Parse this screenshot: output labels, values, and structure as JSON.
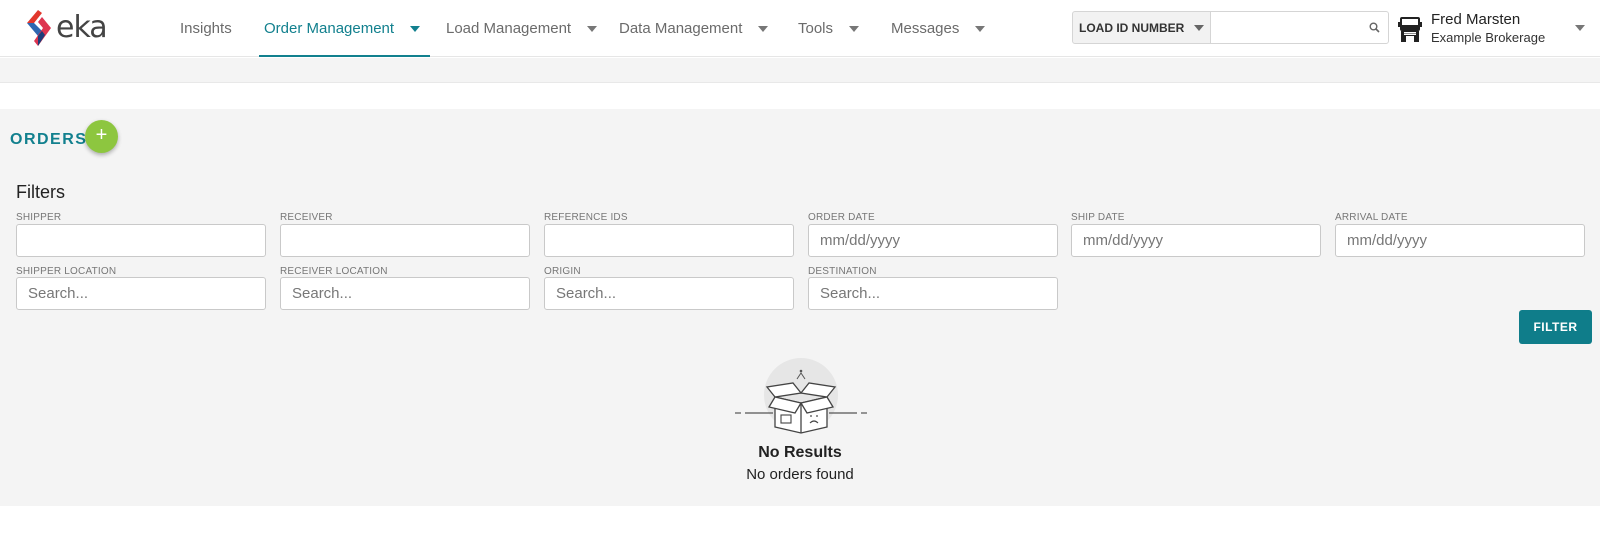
{
  "brand": {
    "logo_text": "eka"
  },
  "nav": {
    "items": [
      {
        "label": "Insights"
      },
      {
        "label": "Order Management"
      },
      {
        "label": "Load Management"
      },
      {
        "label": "Data Management"
      },
      {
        "label": "Tools"
      },
      {
        "label": "Messages"
      }
    ],
    "active": "Order Management"
  },
  "search": {
    "type_label": "LOAD ID NUMBER",
    "value": "",
    "placeholder": ""
  },
  "user": {
    "name": "Fred Marsten",
    "organization": "Example Brokerage"
  },
  "page": {
    "title": "ORDERS",
    "add_label": "+"
  },
  "filters": {
    "title": "Filters",
    "fields": {
      "shipper": {
        "label": "SHIPPER",
        "value": "",
        "placeholder": ""
      },
      "receiver": {
        "label": "RECEIVER",
        "value": "",
        "placeholder": ""
      },
      "reference_ids": {
        "label": "REFERENCE IDS",
        "value": "",
        "placeholder": ""
      },
      "order_date": {
        "label": "ORDER DATE",
        "value": "",
        "placeholder": "mm/dd/yyyy"
      },
      "ship_date": {
        "label": "SHIP DATE",
        "value": "",
        "placeholder": "mm/dd/yyyy"
      },
      "arrival_date": {
        "label": "ARRIVAL DATE",
        "value": "",
        "placeholder": "mm/dd/yyyy"
      },
      "shipper_location": {
        "label": "SHIPPER LOCATION",
        "value": "",
        "placeholder": "Search..."
      },
      "receiver_location": {
        "label": "RECEIVER LOCATION",
        "value": "",
        "placeholder": "Search..."
      },
      "origin": {
        "label": "ORIGIN",
        "value": "",
        "placeholder": "Search..."
      },
      "destination": {
        "label": "DESTINATION",
        "value": "",
        "placeholder": "Search..."
      }
    },
    "submit_label": "FILTER"
  },
  "empty_state": {
    "title": "No Results",
    "message": "No orders found"
  },
  "colors": {
    "accent": "#12808e",
    "add_button": "#8dc63f",
    "filter_button": "#0f7d8a"
  },
  "icons": [
    "eka-logo-icon",
    "search-icon",
    "truck-icon",
    "chevron-down-icon",
    "empty-box-icon"
  ]
}
